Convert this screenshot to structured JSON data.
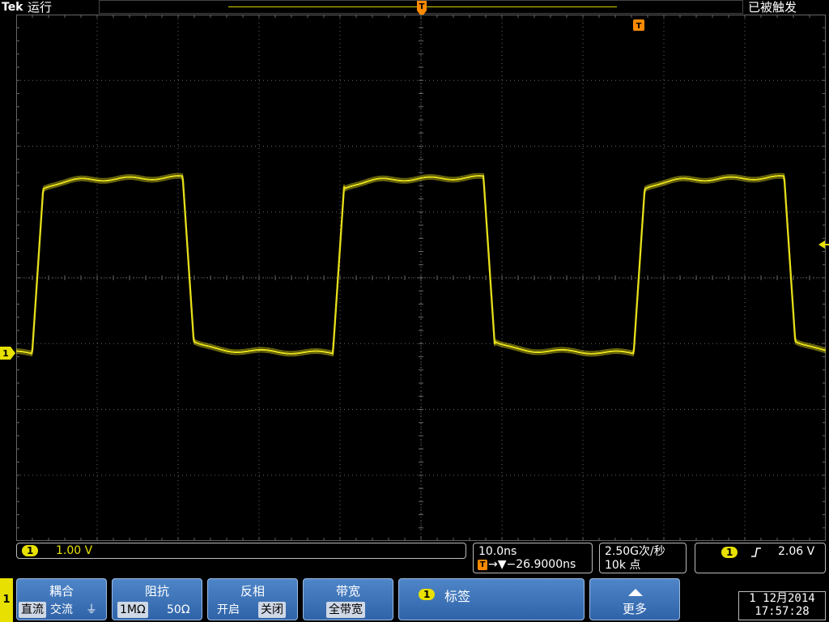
{
  "colors": {
    "trace": "#e6df1a",
    "grid": "#666666",
    "accent": "#e8e000",
    "menu": "#3a70b8",
    "trigger_marker": "#ff8a00"
  },
  "header": {
    "brand": "Tek",
    "run_state": "运行",
    "trigger_status": "已被触发"
  },
  "markers": {
    "channel": "1",
    "trigger": "T"
  },
  "channel": {
    "number": "1",
    "scale": "1.00 V"
  },
  "timebase": {
    "scale": "10.0ns",
    "delay": "→▼−26.9000ns"
  },
  "acquisition": {
    "rate": "2.50G次/秒",
    "points": "10k 点"
  },
  "trigger": {
    "channel": "1",
    "slope_icon": "rising-edge-icon",
    "level": "2.06 V"
  },
  "menu": {
    "side_label": "1",
    "coupling": {
      "title": "耦合",
      "options": [
        "直流",
        "交流",
        "⏚"
      ],
      "selected": 0
    },
    "impedance": {
      "title": "阻抗",
      "options": [
        "1MΩ",
        "50Ω"
      ],
      "selected": 0
    },
    "invert": {
      "title": "反相",
      "options": [
        "开启",
        "关闭"
      ],
      "selected": 1
    },
    "bandwidth": {
      "title": "带宽",
      "value": "全带宽"
    },
    "label": {
      "channel": "1",
      "title": "标签"
    },
    "more": {
      "title": "更多"
    }
  },
  "datetime": {
    "date": "1 12月2014",
    "time": "17:57:28"
  }
}
